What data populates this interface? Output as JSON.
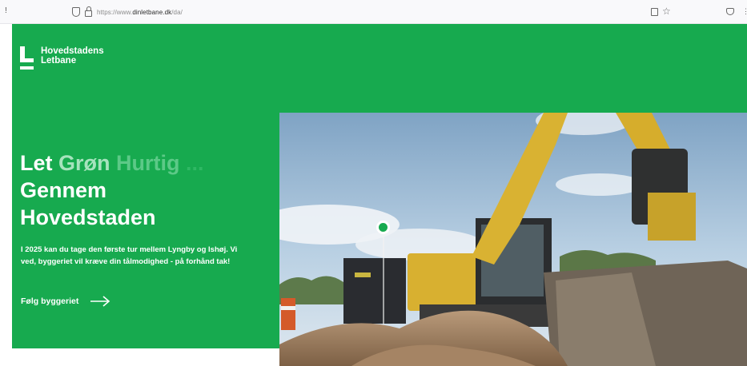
{
  "browser": {
    "nav_glyph": "!",
    "url_scheme": "https://www.",
    "url_host": "dinletbane.dk",
    "url_path": "/da/"
  },
  "hero": {
    "logo_line1": "Hovedstadens",
    "logo_line2": "Letbane",
    "tagline_words": [
      "Let",
      "Grøn",
      "Hurtig",
      "..."
    ],
    "headline_line2": "Gennem",
    "headline_line3": "Hovedstaden",
    "lead": "I 2025 kan du tage den første tur mellem Lyngby og Ishøj. Vi ved, byggeriet vil kræve din tålmodighed - på forhånd tak!",
    "cta_label": "Følg byggeriet"
  },
  "colors": {
    "brand_green": "#17aa4f",
    "text_white": "#ffffff"
  }
}
